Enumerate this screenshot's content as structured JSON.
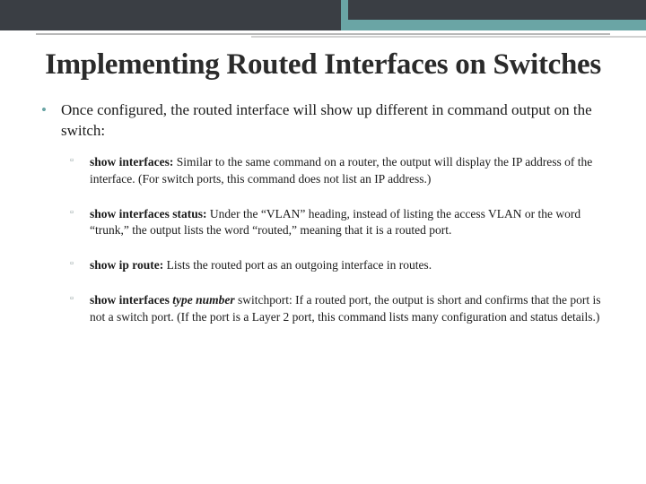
{
  "title": "Implementing Routed Interfaces on Switches",
  "intro": "Once configured, the routed interface will show up different in command output on the switch:",
  "items": [
    {
      "cmd": "show interfaces:",
      "emph": "",
      "desc": " Similar to the same command on a router, the output will display the IP address of the interface. (For switch ports, this command does not list an IP address.)"
    },
    {
      "cmd": "show interfaces status:",
      "emph": "",
      "desc": " Under the “VLAN” heading, instead of listing the access VLAN or the word “trunk,” the output lists the word “routed,” meaning that it is a routed port."
    },
    {
      "cmd": "show ip route:",
      "emph": "",
      "desc": " Lists the routed port as an outgoing interface in routes."
    },
    {
      "cmd": "show interfaces ",
      "emph": "type number",
      "desc": " switchport: If a routed port, the output is short and confirms that the port is not a switch port. (If the port is a Layer 2 port, this command lists many configuration and status details.)"
    }
  ]
}
